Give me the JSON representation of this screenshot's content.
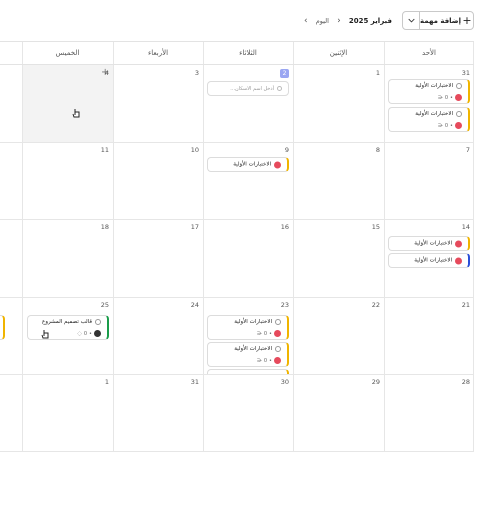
{
  "toolbar": {
    "add_task_label": "إضافة مهمة",
    "today_label": "اليوم",
    "month_label": "فبراير 2025"
  },
  "day_headers": [
    "الأحد",
    "الإثنين",
    "الثلاثاء",
    "الأربعاء",
    "الخميس"
  ],
  "weeks": [
    [
      "31",
      "1",
      "2",
      "3",
      "4"
    ],
    [
      "7",
      "8",
      "9",
      "10",
      "11"
    ],
    [
      "14",
      "15",
      "16",
      "17",
      "18"
    ],
    [
      "21",
      "22",
      "23",
      "24",
      "25"
    ],
    [
      "28",
      "29",
      "30",
      "31",
      "1"
    ]
  ],
  "tasks": {
    "initial_tests": "الاختبارات الأولية",
    "design_template": "قالب تصميم المشروع",
    "new_task_placeholder": "أدخل اسم الاسكان..."
  },
  "meta": {
    "count": "0",
    "dot": "•"
  },
  "colors": {
    "accent_yellow": "#f0b400",
    "accent_blue": "#2b4fd8",
    "accent_green": "#1a9c4a",
    "today_badge": "#9aa6f2"
  }
}
